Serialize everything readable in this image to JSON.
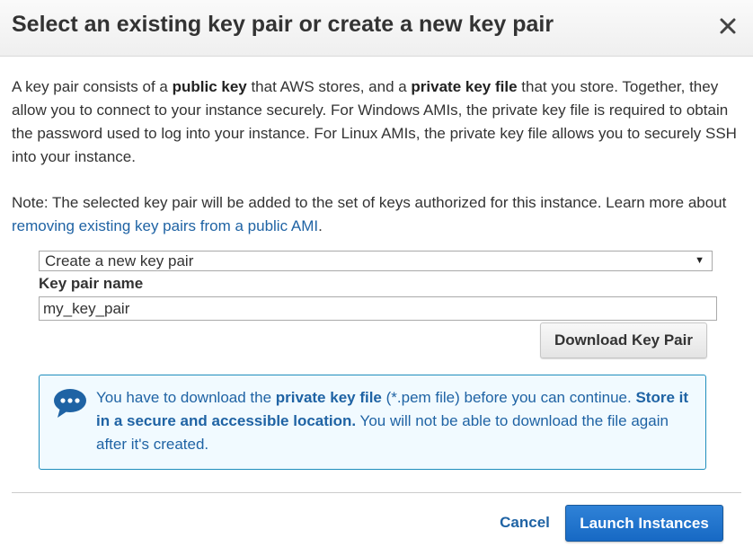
{
  "dialog": {
    "title": "Select an existing key pair or create a new key pair",
    "close_icon": "close-icon"
  },
  "intro": {
    "t1": "A key pair consists of a ",
    "b1": "public key",
    "t2": " that AWS stores, and a ",
    "b2": "private key file",
    "t3": " that you store. Together, they allow you to connect to your instance securely. For Windows AMIs, the private key file is required to obtain the password used to log into your instance. For Linux AMIs, the private key file allows you to securely SSH into your instance."
  },
  "note": {
    "text": "Note: The selected key pair will be added to the set of keys authorized for this instance. Learn more about ",
    "link": "removing existing key pairs from a public AMI",
    "suffix": "."
  },
  "keypair_select": {
    "selected": "Create a new key pair",
    "arrow": "▼"
  },
  "keypair_name": {
    "label": "Key pair name",
    "value": "my_key_pair"
  },
  "download_button": {
    "label": "Download Key Pair"
  },
  "info_box": {
    "icon": "speech-bubble-icon",
    "t1": "You have to download the ",
    "b1": "private key file",
    "t2": " (*.pem file) before you can continue. ",
    "b2": "Store it in a secure and accessible location.",
    "t3": " You will not be able to download the file again after it's created."
  },
  "footer": {
    "cancel_label": "Cancel",
    "launch_label": "Launch Instances"
  },
  "colors": {
    "link": "#1f63a4",
    "primary_button": "#1f75cc",
    "info_border": "#1f8ebd",
    "info_background": "#f1faff"
  }
}
